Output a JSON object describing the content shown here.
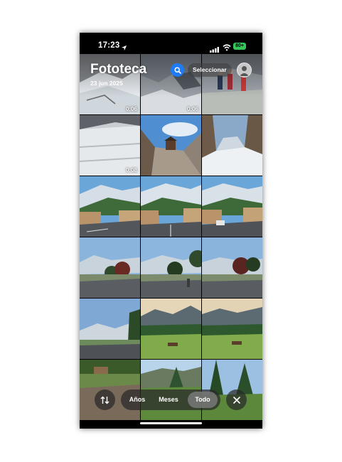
{
  "status_bar": {
    "time": "17:23",
    "battery": "80+"
  },
  "header": {
    "title": "Fototeca",
    "date": "23 jun 2025",
    "select_label": "Seleccionar"
  },
  "tiles": [
    {
      "duration": "0:06"
    },
    {
      "duration": "0:06"
    },
    {
      "duration": ""
    },
    {
      "duration": "0:08"
    },
    {
      "duration": ""
    },
    {
      "duration": ""
    },
    {
      "duration": ""
    },
    {
      "duration": ""
    },
    {
      "duration": ""
    },
    {
      "duration": ""
    },
    {
      "duration": ""
    },
    {
      "duration": ""
    },
    {
      "duration": ""
    },
    {
      "duration": ""
    },
    {
      "duration": ""
    },
    {
      "duration": ""
    },
    {
      "duration": ""
    },
    {
      "duration": ""
    }
  ],
  "bottom_bar": {
    "years": "Años",
    "months": "Meses",
    "all": "Todo",
    "active": "all"
  },
  "colors": {
    "accent": "#1f7bf5",
    "battery": "#35c759"
  }
}
